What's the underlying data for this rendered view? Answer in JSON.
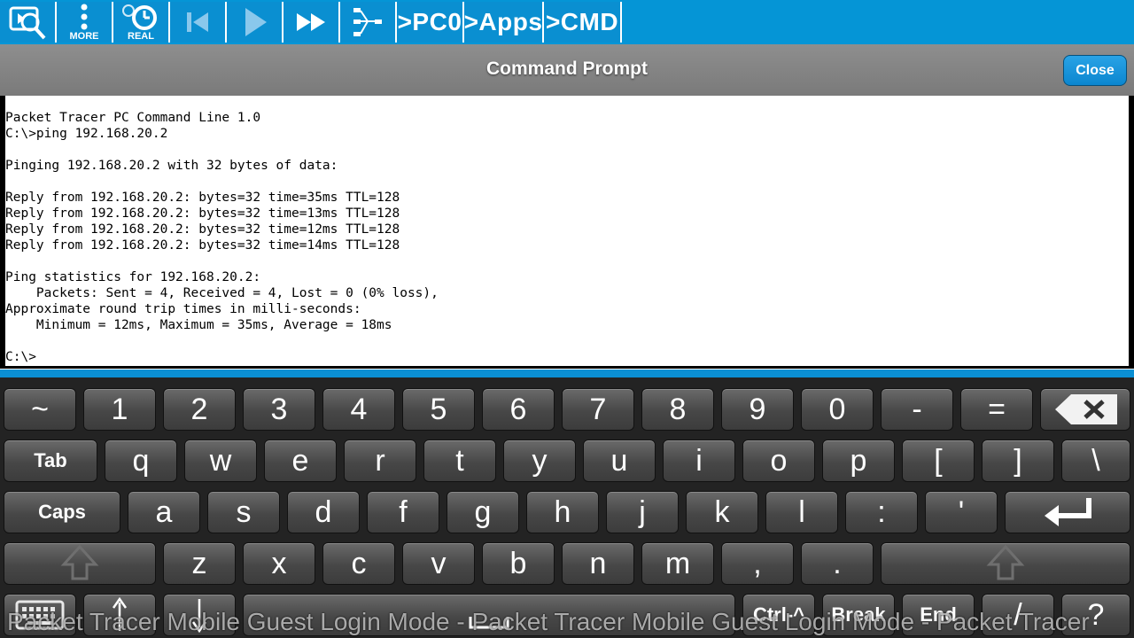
{
  "toolbar": {
    "more_label": "MORE",
    "real_label": "REAL",
    "crumbs": [
      ">PC0",
      ">Apps",
      ">CMD"
    ]
  },
  "window": {
    "title": "Command Prompt",
    "close_label": "Close"
  },
  "terminal": {
    "output": "Packet Tracer PC Command Line 1.0\nC:\\>ping 192.168.20.2\n\nPinging 192.168.20.2 with 32 bytes of data:\n\nReply from 192.168.20.2: bytes=32 time=35ms TTL=128\nReply from 192.168.20.2: bytes=32 time=13ms TTL=128\nReply from 192.168.20.2: bytes=32 time=12ms TTL=128\nReply from 192.168.20.2: bytes=32 time=14ms TTL=128\n\nPing statistics for 192.168.20.2:\n    Packets: Sent = 4, Received = 4, Lost = 0 (0% loss),\nApproximate round trip times in milli-seconds:\n    Minimum = 12ms, Maximum = 35ms, Average = 18ms\n\nC:\\>"
  },
  "keyboard": {
    "row1": [
      "~",
      "1",
      "2",
      "3",
      "4",
      "5",
      "6",
      "7",
      "8",
      "9",
      "0",
      "-",
      "="
    ],
    "row2": [
      "Tab",
      "q",
      "w",
      "e",
      "r",
      "t",
      "y",
      "u",
      "i",
      "o",
      "p",
      "[",
      "]",
      "\\"
    ],
    "row3": [
      "Caps",
      "a",
      "s",
      "d",
      "f",
      "g",
      "h",
      "j",
      "k",
      "l",
      ":",
      "'"
    ],
    "row4": [
      "z",
      "x",
      "c",
      "v",
      "b",
      "n",
      "m",
      ",",
      "."
    ],
    "row5": [
      "Ctrl-^",
      "Break",
      "End",
      "/",
      "?"
    ]
  },
  "watermark": "Packet Tracer Mobile Guest Login Mode - Packet Tracer Mobile Guest Login Mode - Packet Tracer",
  "colors": {
    "toolbar_blue": "#0595d6",
    "title_gray": "#808080",
    "key_gray": "#4a4a4a"
  }
}
